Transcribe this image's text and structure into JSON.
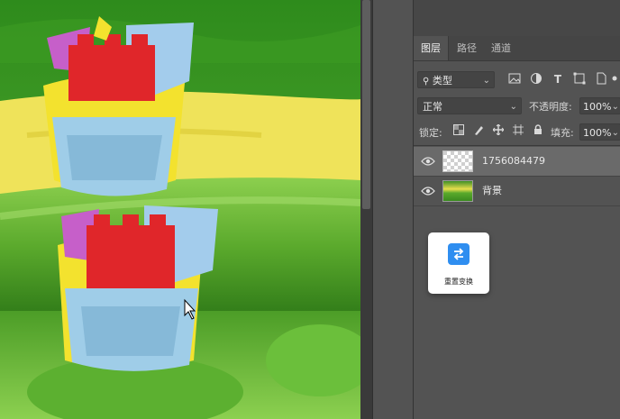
{
  "panel": {
    "tabs": [
      {
        "label": "图层",
        "active": true
      },
      {
        "label": "路径",
        "active": false
      },
      {
        "label": "通道",
        "active": false
      }
    ],
    "filter": {
      "label": "类型"
    },
    "blend_mode": "正常",
    "opacity": {
      "label": "不透明度:",
      "value": "100%"
    },
    "lock": {
      "label": "锁定:"
    },
    "fill": {
      "label": "填充:",
      "value": "100%"
    },
    "layers": [
      {
        "name": "1756084479",
        "selected": true,
        "visible": true
      },
      {
        "name": "背景",
        "selected": false,
        "visible": true
      }
    ]
  },
  "reset_button": {
    "label": "重置变换",
    "icon": "reset-transform-icon"
  },
  "colors": {
    "accent": "#2f8ef0",
    "panel_bg": "#535353",
    "selected_row": "#6a6a6a"
  }
}
